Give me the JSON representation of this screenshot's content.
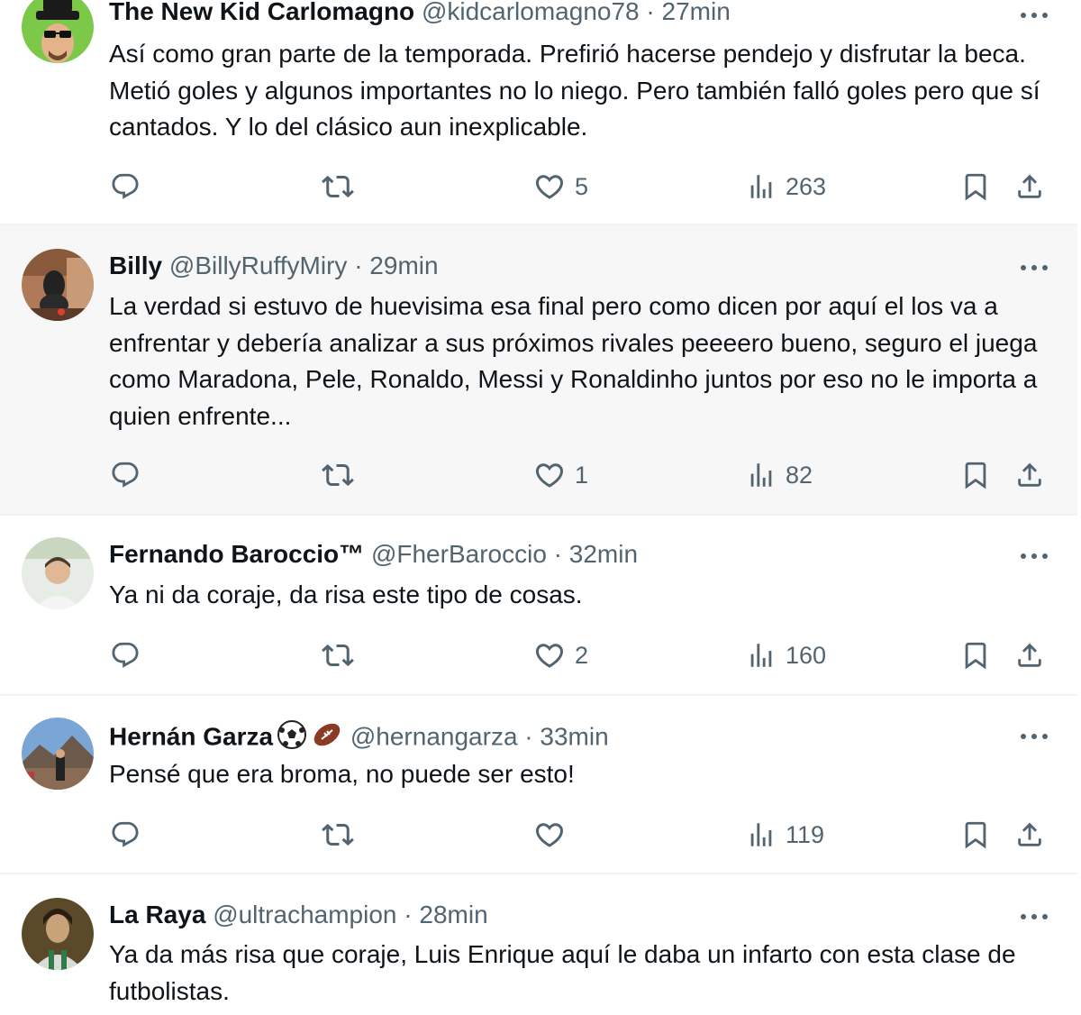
{
  "tweets": [
    {
      "name": "The New Kid Carlomagno",
      "handle": "@kidcarlomagno78",
      "separator": "·",
      "time": "27min",
      "text": "Así como gran parte de la temporada. Prefirió hacerse pendejo y disfrutar la beca. Metió goles y algunos importantes no lo niego. Pero también falló goles pero que sí cantados. Y lo del clásico aun inexplicable.",
      "likes": "5",
      "views": "263",
      "avatar_icon": "heisenberg-avatar",
      "highlighted": false
    },
    {
      "name": "Billy",
      "handle": "@BillyRuffyMiry",
      "separator": "·",
      "time": "29min",
      "text": "La verdad si estuvo de huevisima esa final pero como dicen por aquí el los va a enfrentar y debería analizar a sus próximos rivales peeeero bueno, seguro el juega como Maradona, Pele, Ronaldo, Messi y Ronaldinho juntos por eso no le importa a quien enfrente...",
      "likes": "1",
      "views": "82",
      "avatar_icon": "dog-photo-avatar",
      "highlighted": true
    },
    {
      "name": "Fernando Baroccio™",
      "handle": "@FherBaroccio",
      "separator": "·",
      "time": "32min",
      "text": "Ya ni da coraje, da risa este tipo de cosas.",
      "likes": "2",
      "views": "160",
      "avatar_icon": "person-photo-avatar",
      "highlighted": false
    },
    {
      "name": "Hernán Garza",
      "name_emojis": [
        "soccer-ball-emoji",
        "american-football-emoji"
      ],
      "handle": "@hernangarza",
      "separator": "·",
      "time": "33min",
      "text": "Pensé que era broma, no puede ser esto!",
      "likes": "",
      "views": "119",
      "avatar_icon": "mountain-photo-avatar",
      "highlighted": false
    },
    {
      "name": "La Raya",
      "handle": "@ultrachampion",
      "separator": "·",
      "time": "28min",
      "text": "Ya da más risa que coraje, Luis Enrique aquí le daba un infarto con esta clase de futbolistas.",
      "likes": null,
      "views": null,
      "avatar_icon": "portrait-painting-avatar",
      "highlighted": false
    }
  ],
  "action_icons": [
    "reply-icon",
    "retweet-icon",
    "like-icon",
    "views-icon",
    "bookmark-icon",
    "share-icon"
  ],
  "colors": {
    "text": "#0f1419",
    "secondary": "#536471",
    "divider": "#eff3f4",
    "highlight_bg": "#f7f7f7"
  }
}
